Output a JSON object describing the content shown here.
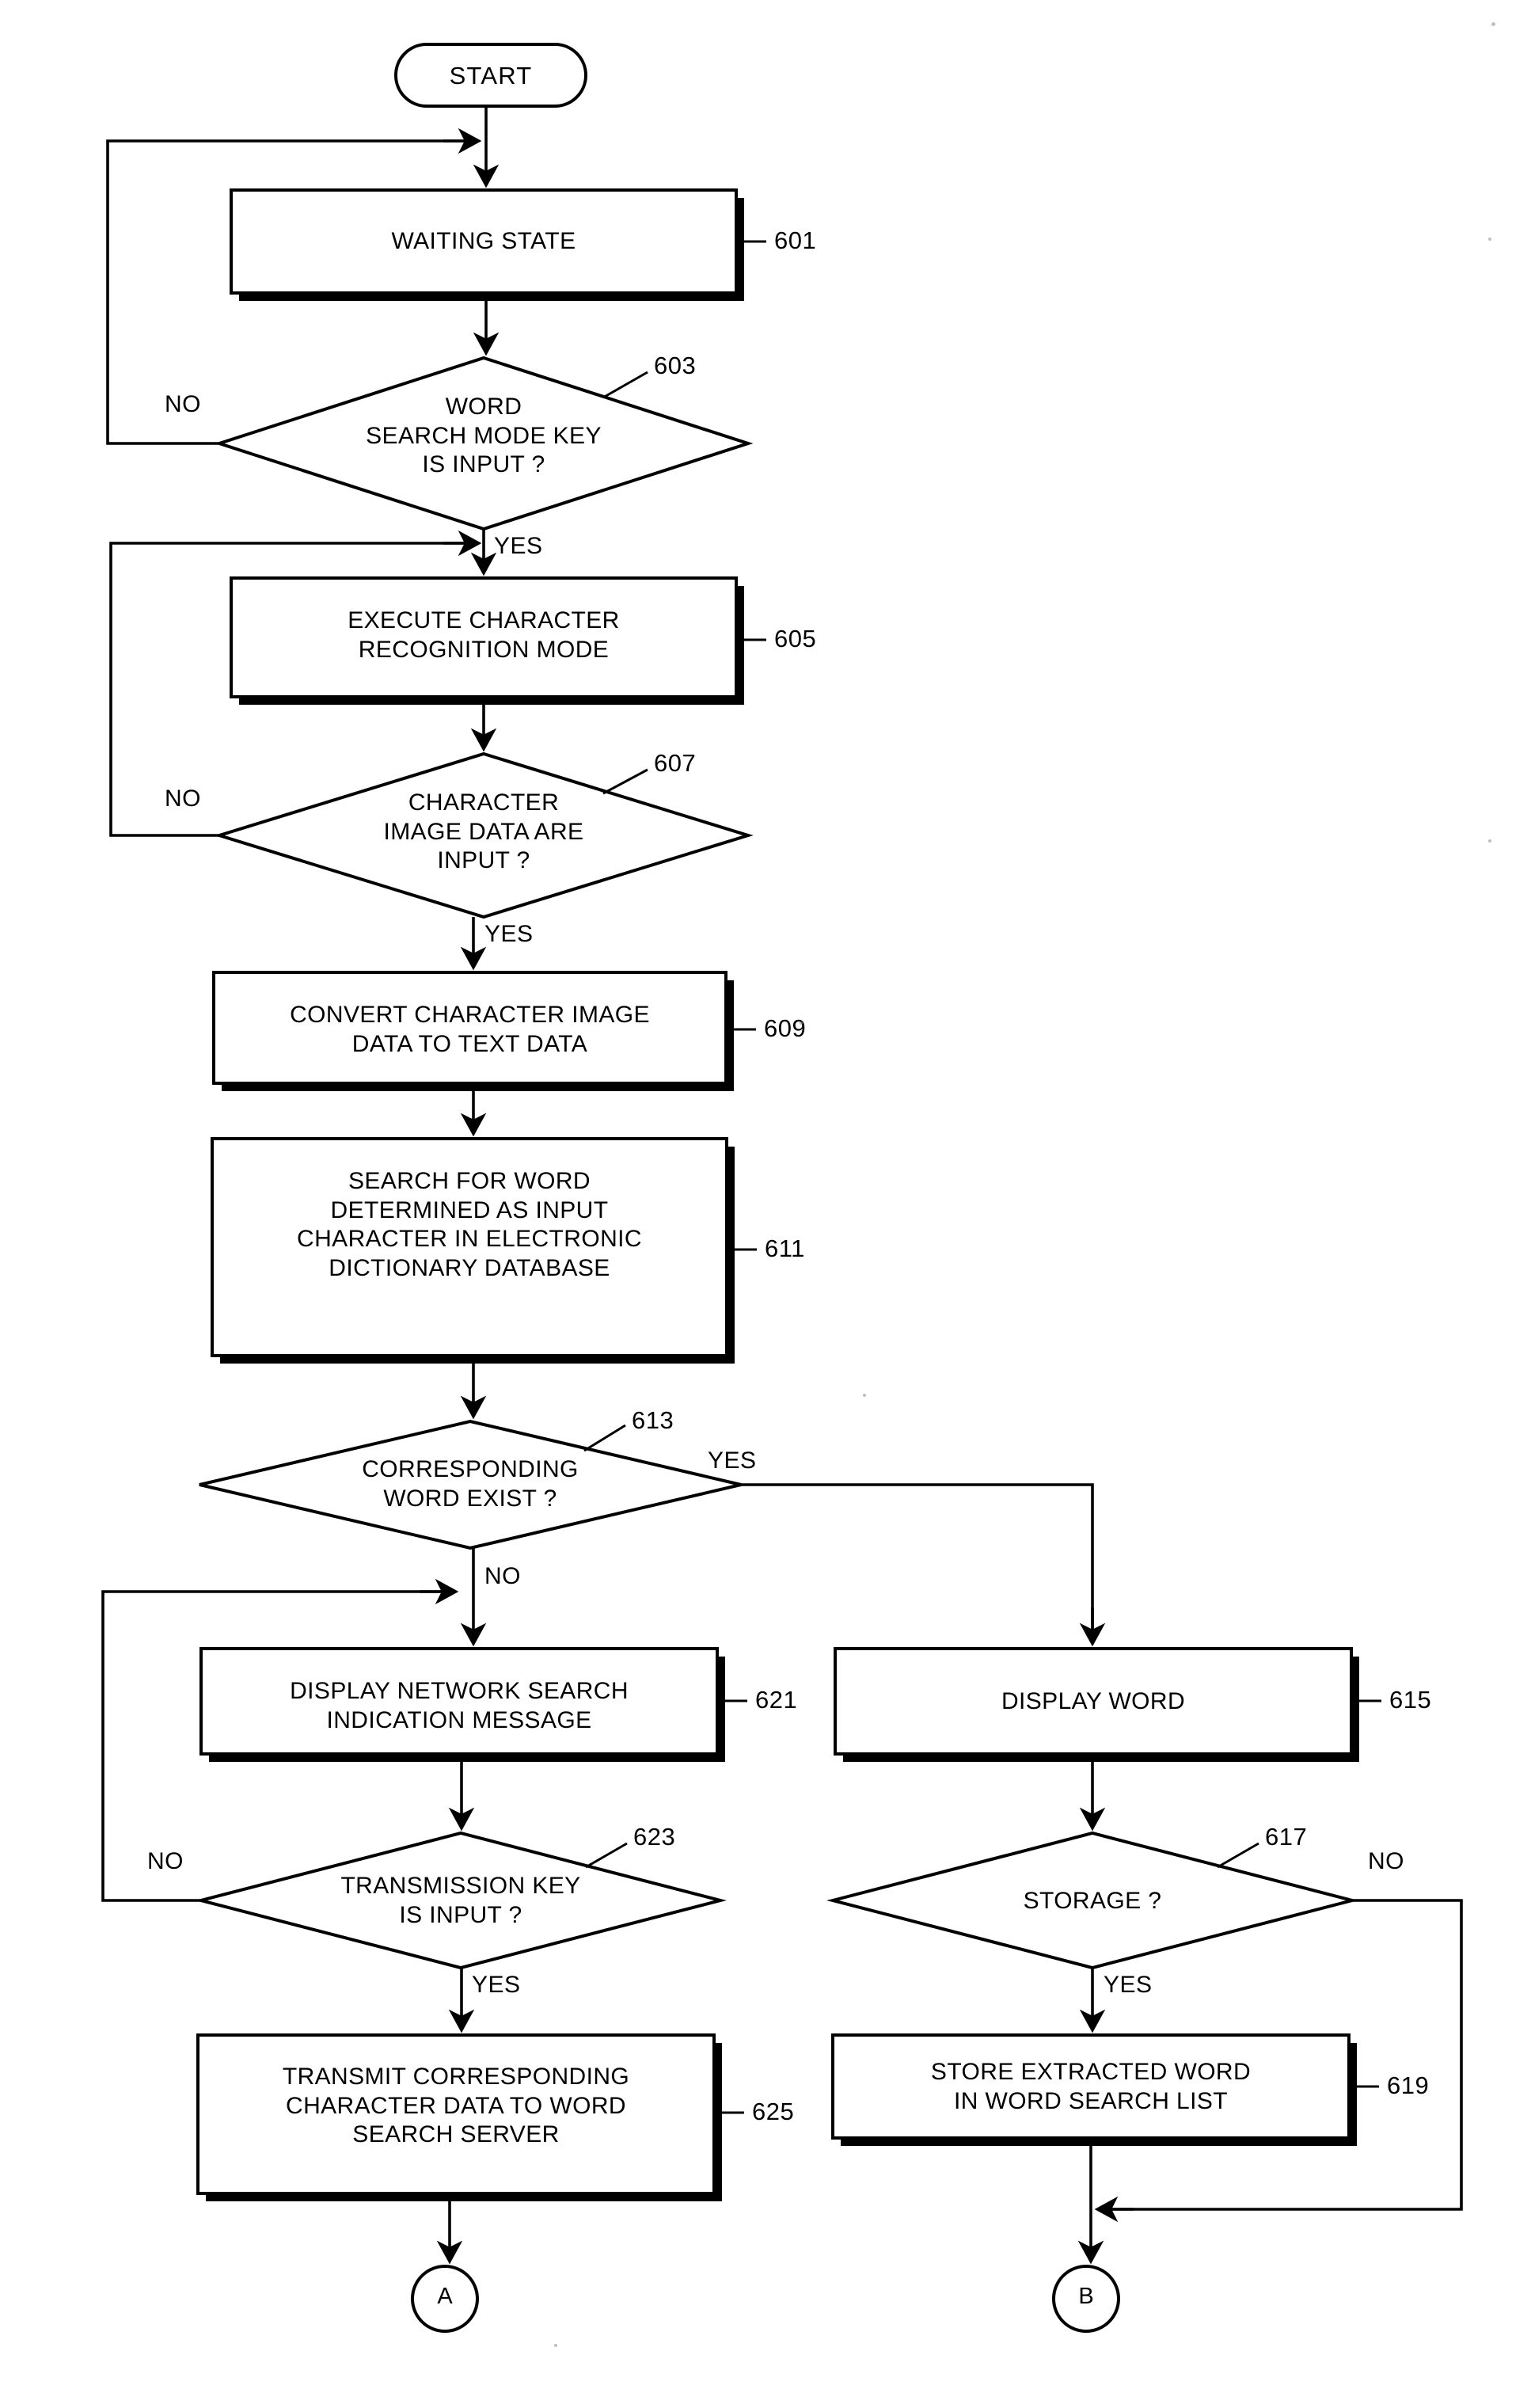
{
  "figure": {
    "type": "flowchart",
    "title": "",
    "orientation": "top-to-bottom, two branches"
  },
  "terminators": {
    "start": "START",
    "connector_a": "A",
    "connector_b": "B"
  },
  "nodes": [
    {
      "id": "601",
      "shape": "process",
      "text": "WAITING STATE",
      "ref": "601"
    },
    {
      "id": "603",
      "shape": "decision",
      "text": "WORD\nSEARCH MODE KEY\nIS INPUT ?",
      "ref": "603"
    },
    {
      "id": "605",
      "shape": "process",
      "text": "EXECUTE CHARACTER\nRECOGNITION MODE",
      "ref": "605"
    },
    {
      "id": "607",
      "shape": "decision",
      "text": "CHARACTER\nIMAGE DATA ARE\nINPUT ?",
      "ref": "607"
    },
    {
      "id": "609",
      "shape": "process",
      "text": "CONVERT CHARACTER IMAGE\nDATA TO TEXT DATA",
      "ref": "609"
    },
    {
      "id": "611",
      "shape": "process",
      "text": "SEARCH FOR WORD\nDETERMINED AS INPUT\nCHARACTER IN ELECTRONIC\nDICTIONARY DATABASE",
      "ref": "611"
    },
    {
      "id": "613",
      "shape": "decision",
      "text": "CORRESPONDING\nWORD EXIST ?",
      "ref": "613"
    },
    {
      "id": "621",
      "shape": "process",
      "text": "DISPLAY NETWORK SEARCH\nINDICATION MESSAGE",
      "ref": "621"
    },
    {
      "id": "615",
      "shape": "process",
      "text": "DISPLAY WORD",
      "ref": "615"
    },
    {
      "id": "623",
      "shape": "decision",
      "text": "TRANSMISSION KEY\nIS INPUT ?",
      "ref": "623"
    },
    {
      "id": "617",
      "shape": "decision",
      "text": "STORAGE ?",
      "ref": "617"
    },
    {
      "id": "625",
      "shape": "process",
      "text": "TRANSMIT CORRESPONDING\nCHARACTER DATA TO WORD\nSEARCH SERVER",
      "ref": "625"
    },
    {
      "id": "619",
      "shape": "process",
      "text": "STORE EXTRACTED WORD\nIN WORD SEARCH LIST",
      "ref": "619"
    }
  ],
  "edge_labels": {
    "no_603": "NO",
    "yes_603": "YES",
    "no_607": "NO",
    "yes_607": "YES",
    "yes_613": "YES",
    "no_613": "NO",
    "no_623": "NO",
    "yes_623": "YES",
    "no_617": "NO",
    "yes_617": "YES"
  },
  "colors": {
    "stroke": "#000000",
    "background": "#ffffff",
    "shadow": "#000000"
  }
}
